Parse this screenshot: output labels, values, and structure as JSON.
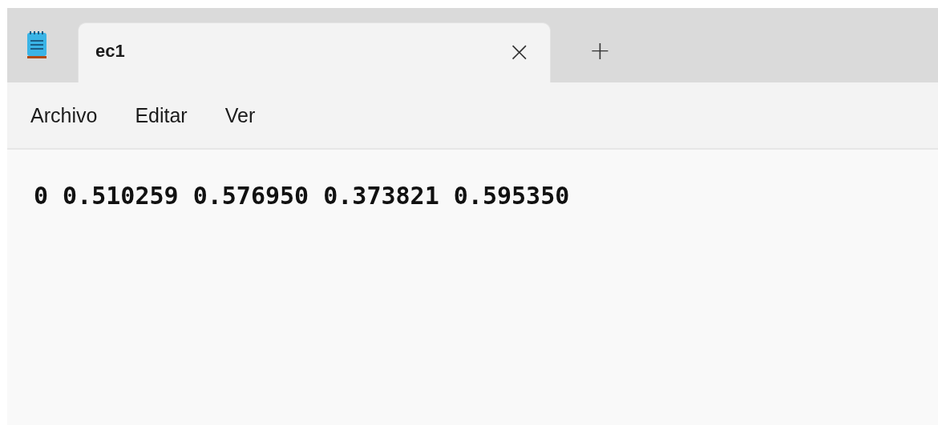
{
  "tabs": [
    {
      "title": "ec1",
      "selected": true,
      "close": "×"
    }
  ],
  "new_tab": "+",
  "menu": [
    "Archivo",
    "Editar",
    "Ver"
  ],
  "editor": {
    "lines": [
      "0 0.510259 0.576950 0.373821 0.595350"
    ]
  }
}
